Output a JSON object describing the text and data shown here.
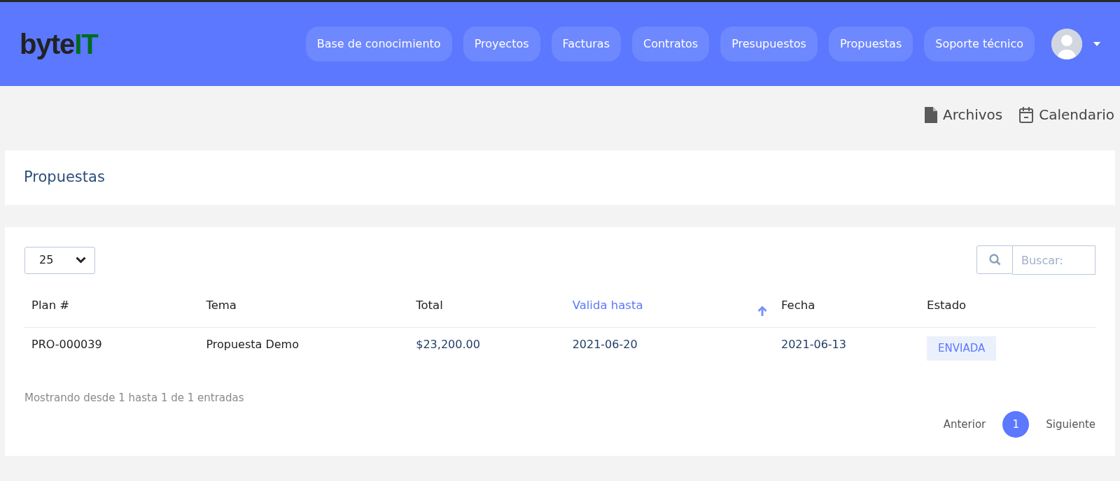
{
  "header": {
    "logo": {
      "text": "byte",
      "accent": "IT"
    },
    "nav": [
      {
        "label": "Base de conocimiento",
        "selected": false
      },
      {
        "label": "Proyectos",
        "selected": false
      },
      {
        "label": "Facturas",
        "selected": false
      },
      {
        "label": "Contratos",
        "selected": false
      },
      {
        "label": "Presupuestos",
        "selected": false
      },
      {
        "label": "Propuestas",
        "selected": false
      },
      {
        "label": "Soporte técnico",
        "selected": false
      }
    ]
  },
  "toolbar": [
    {
      "kind": "file",
      "label": "Archivos"
    },
    {
      "kind": "calendar",
      "label": "Calendario"
    }
  ],
  "page_title": "Propuestas",
  "table": {
    "page_size": "25",
    "search": {
      "placeholder": "Buscar:"
    },
    "columns": [
      {
        "label": "Plan #",
        "sorted": false
      },
      {
        "label": "Tema",
        "sorted": false
      },
      {
        "label": "Total",
        "sorted": false
      },
      {
        "label": "Valida hasta",
        "sorted": true
      },
      {
        "label": "Fecha",
        "sorted": false
      },
      {
        "label": "Estado",
        "sorted": false
      }
    ],
    "rows": [
      [
        {
          "kind": "text",
          "text": "PRO-000039"
        },
        {
          "kind": "text",
          "text": "Propuesta Demo"
        },
        {
          "kind": "link",
          "text": "$23,200.00"
        },
        {
          "kind": "link",
          "text": "2021-06-20"
        },
        {
          "kind": "link",
          "text": "2021-06-13"
        },
        {
          "kind": "badge",
          "text": "ENVIADA"
        }
      ]
    ],
    "info": "Mostrando desde 1 hasta 1 de 1 entradas",
    "pagination": {
      "previous": "Anterior",
      "pages": [
        {
          "label": "1",
          "selected": true
        }
      ],
      "next": "Siguiente"
    }
  }
}
